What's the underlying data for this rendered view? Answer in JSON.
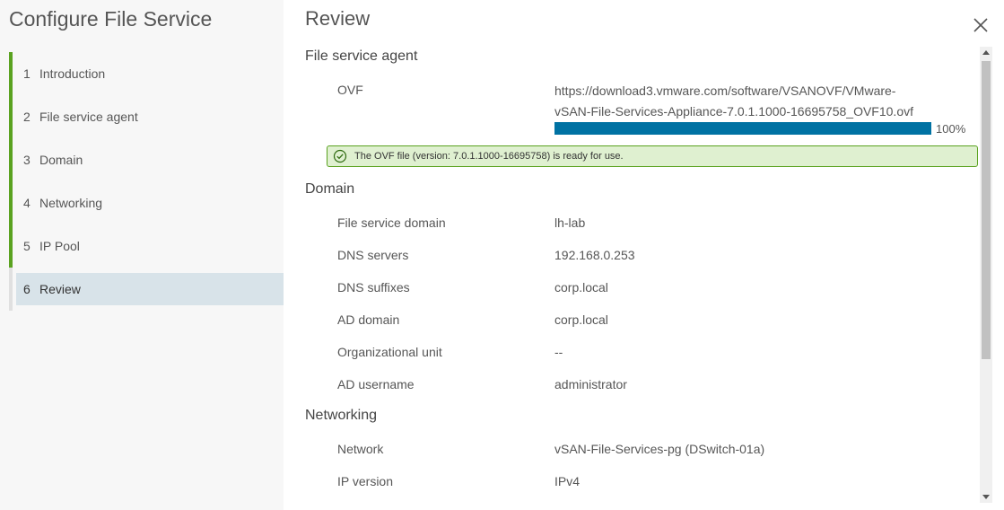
{
  "wizard": {
    "title": "Configure File Service",
    "steps": [
      {
        "number": "1",
        "label": "Introduction"
      },
      {
        "number": "2",
        "label": "File service agent"
      },
      {
        "number": "3",
        "label": "Domain"
      },
      {
        "number": "4",
        "label": "Networking"
      },
      {
        "number": "5",
        "label": "IP Pool"
      },
      {
        "number": "6",
        "label": "Review"
      }
    ],
    "active_step": "6",
    "completed_color": "#5aa220",
    "active_bg": "#d8e3e9"
  },
  "page": {
    "title": "Review",
    "close_icon": "close-icon"
  },
  "file_service_agent": {
    "title": "File service agent",
    "ovf_label": "OVF",
    "ovf_url_line1": "https://download3.vmware.com/software/VSANOVF/VMware-",
    "ovf_url_line2": "vSAN-File-Services-Appliance-7.0.1.1000-16695758_OVF10.ovf",
    "progress_fraction": 1.0,
    "progress_text": "100%",
    "progress_color": "#0072a3",
    "alert_text": "The OVF file (version: 7.0.1.1000-16695758) is ready for use.",
    "alert_icon": "check-circle-icon",
    "alert_color": "#5aa220"
  },
  "domain": {
    "title": "Domain",
    "rows": [
      {
        "label": "File service domain",
        "value": "lh-lab"
      },
      {
        "label": "DNS servers",
        "value": "192.168.0.253"
      },
      {
        "label": "DNS suffixes",
        "value": "corp.local"
      },
      {
        "label": "AD domain",
        "value": "corp.local"
      },
      {
        "label": "Organizational unit",
        "value": "--"
      },
      {
        "label": "AD username",
        "value": "administrator"
      }
    ]
  },
  "networking": {
    "title": "Networking",
    "rows": [
      {
        "label": "Network",
        "value": "vSAN-File-Services-pg (DSwitch-01a)"
      },
      {
        "label": "IP version",
        "value": "IPv4"
      }
    ]
  }
}
